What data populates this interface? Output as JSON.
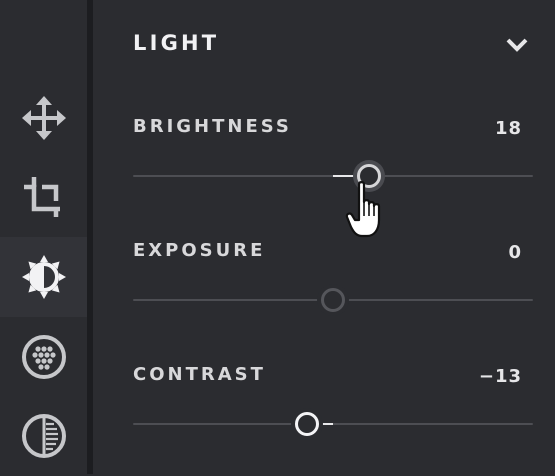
{
  "sidebar": {
    "items": [
      {
        "name": "move-icon",
        "active": false
      },
      {
        "name": "crop-icon",
        "active": false
      },
      {
        "name": "light-icon",
        "active": true
      },
      {
        "name": "color-icon",
        "active": false
      },
      {
        "name": "detail-icon",
        "active": false
      }
    ]
  },
  "section": {
    "title": "LIGHT",
    "icon": "chevron-down-icon"
  },
  "controls": {
    "brightness": {
      "label": "BRIGHTNESS",
      "value": "18",
      "level": 18
    },
    "exposure": {
      "label": "EXPOSURE",
      "value": "0",
      "level": 0
    },
    "contrast": {
      "label": "CONTRAST",
      "value": "−13",
      "level": -13
    }
  },
  "slider_range": [
    -100,
    100
  ],
  "colors": {
    "background": "#2b2c30",
    "active": "#323338",
    "text": "#e4e4e6",
    "track": "#4d4e53"
  }
}
